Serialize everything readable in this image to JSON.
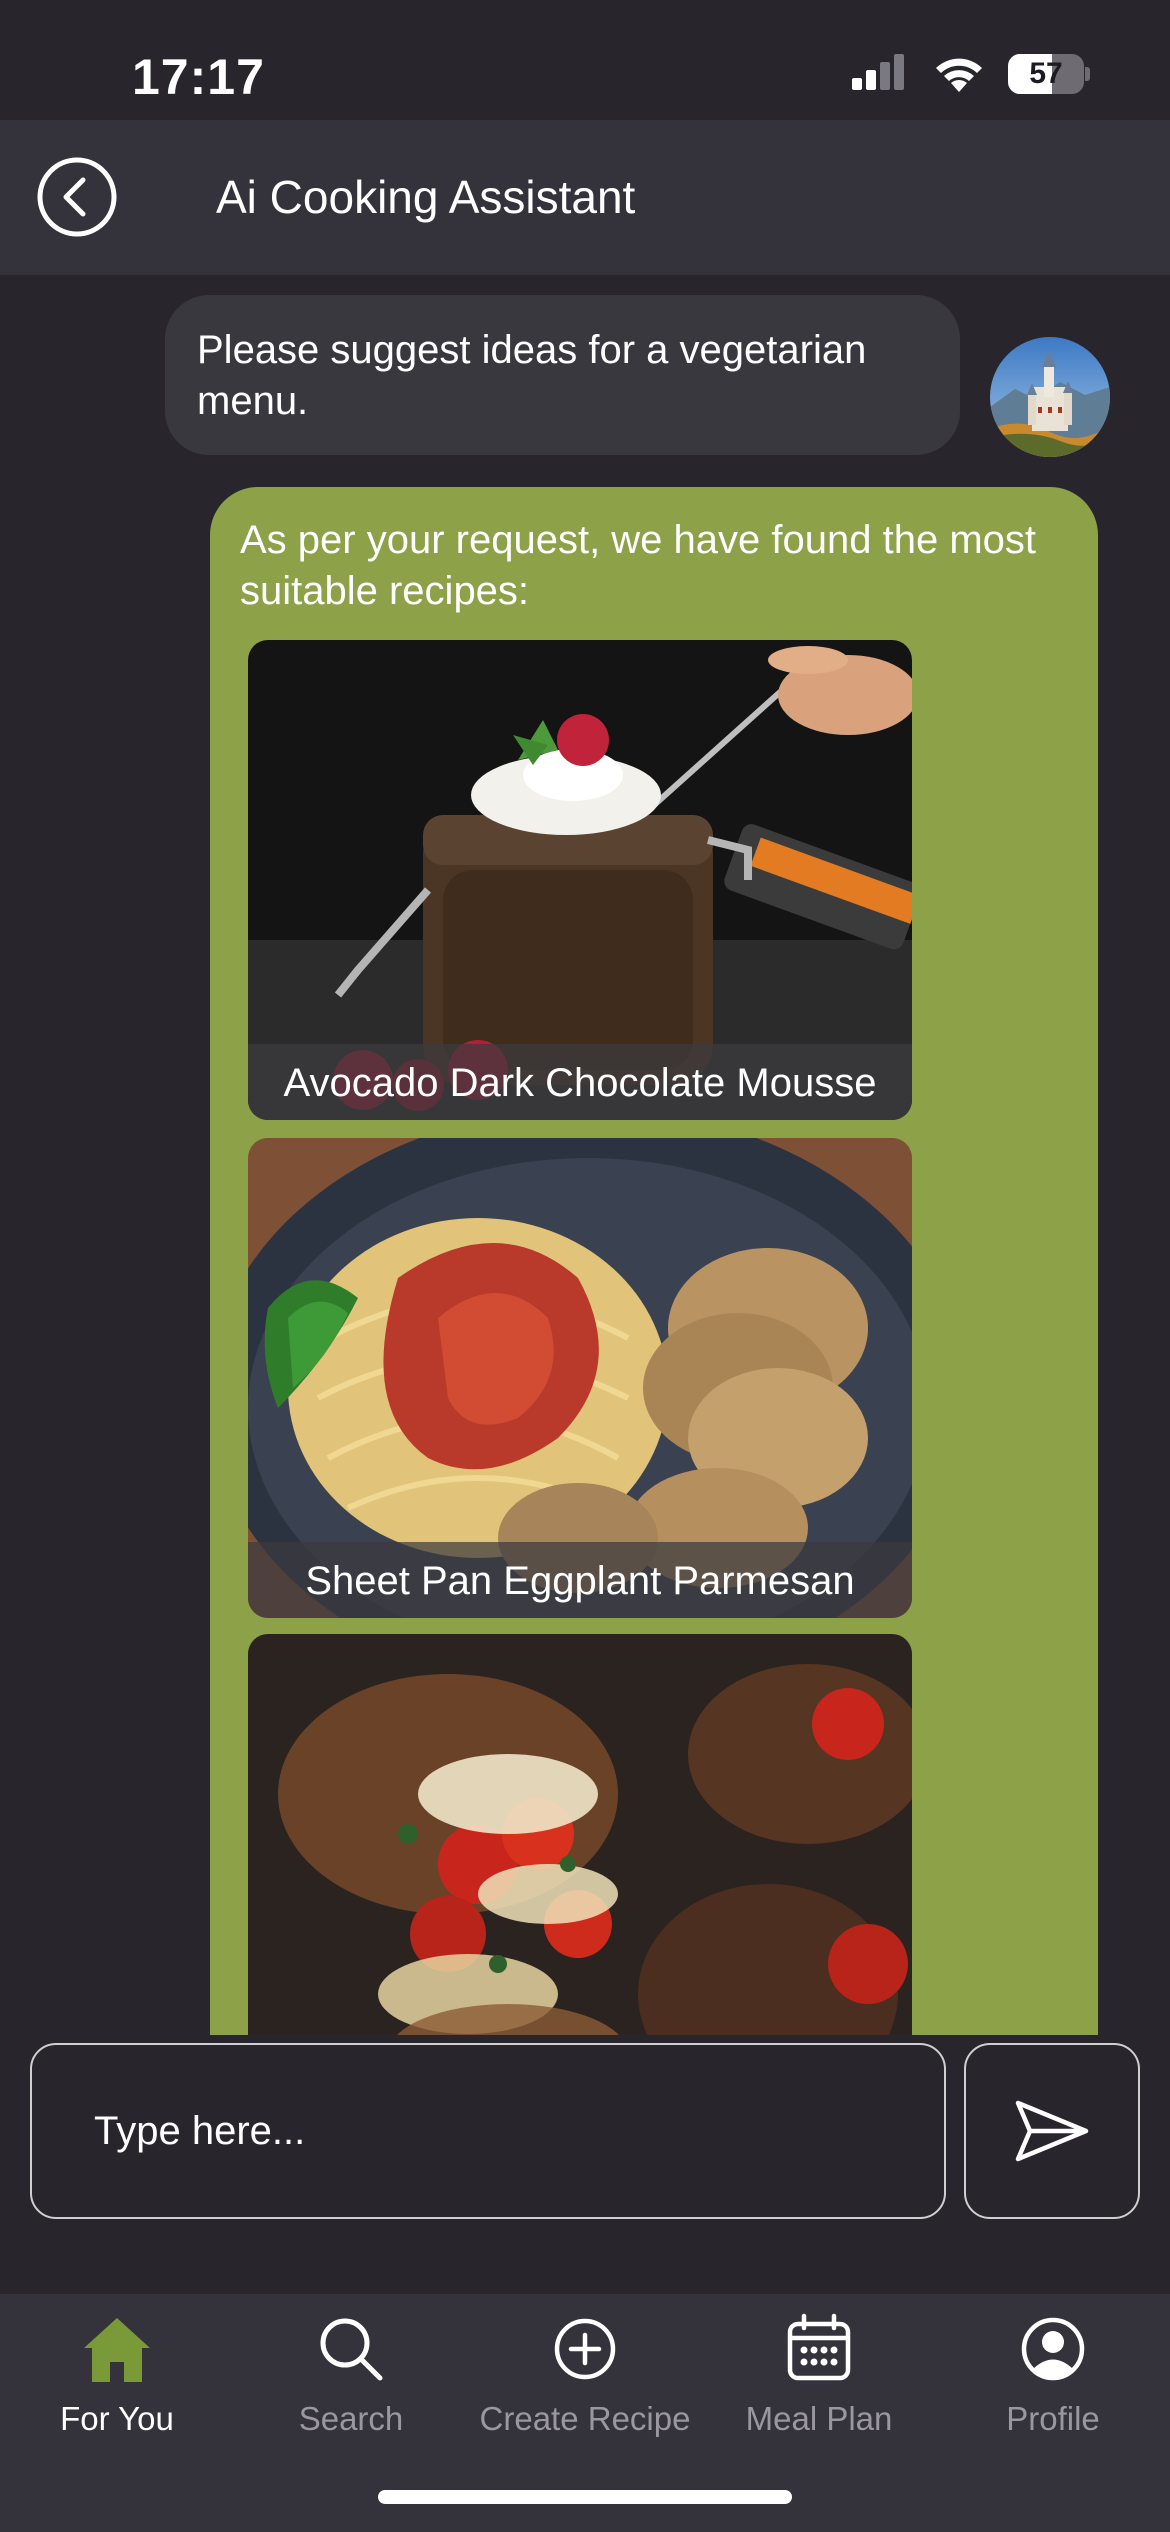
{
  "status_bar": {
    "time": "17:17",
    "battery_level": "57",
    "icons": [
      "cellular-signal-icon",
      "wifi-icon",
      "battery-icon"
    ]
  },
  "header": {
    "title": "Ai Cooking Assistant",
    "back_icon": "back-chevron-icon"
  },
  "chat": {
    "user_message": "Please suggest ideas for a vegetarian menu.",
    "bot_message": "As per your request, we have found the most suitable recipes:",
    "recipes": [
      {
        "title": "Avocado Dark Chocolate Mousse"
      },
      {
        "title": "Sheet Pan Eggplant Parmesan"
      },
      {
        "title": ""
      }
    ]
  },
  "composer": {
    "placeholder": "Type here...",
    "send_icon": "send-icon"
  },
  "tabbar": {
    "items": [
      {
        "label": "For You",
        "icon": "home-icon",
        "active": true
      },
      {
        "label": "Search",
        "icon": "search-icon",
        "active": false
      },
      {
        "label": "Create Recipe",
        "icon": "plus-circle-icon",
        "active": false
      },
      {
        "label": "Meal Plan",
        "icon": "calendar-icon",
        "active": false
      },
      {
        "label": "Profile",
        "icon": "profile-icon",
        "active": false
      }
    ]
  },
  "colors": {
    "background": "#28262c",
    "surface": "#34323a",
    "bot_bubble": "#8ca148",
    "accent": "#7a9a3a",
    "inactive_tab": "#9a989e"
  }
}
